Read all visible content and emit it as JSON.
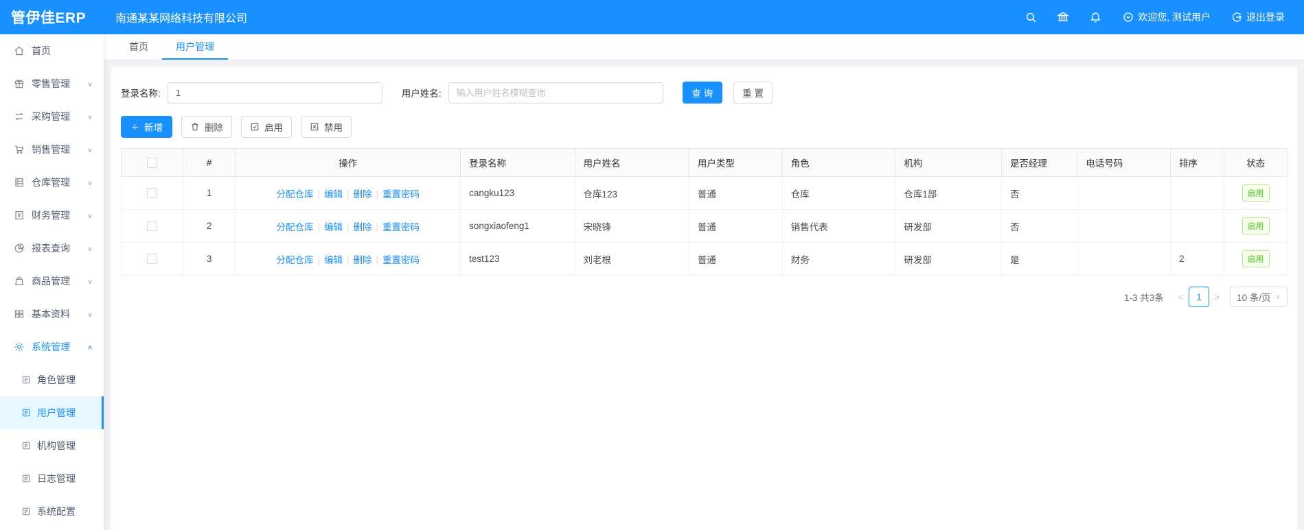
{
  "header": {
    "logo": "管伊佳ERP",
    "company": "南通某某网络科技有限公司",
    "welcome": "欢迎您, 测试用户",
    "logout": "退出登录"
  },
  "sidebar": {
    "items": [
      {
        "label": "首页"
      },
      {
        "label": "零售管理"
      },
      {
        "label": "采购管理"
      },
      {
        "label": "销售管理"
      },
      {
        "label": "仓库管理"
      },
      {
        "label": "财务管理"
      },
      {
        "label": "报表查询"
      },
      {
        "label": "商品管理"
      },
      {
        "label": "基本资料"
      },
      {
        "label": "系统管理"
      }
    ],
    "subitems": [
      {
        "label": "角色管理"
      },
      {
        "label": "用户管理"
      },
      {
        "label": "机构管理"
      },
      {
        "label": "日志管理"
      },
      {
        "label": "系统配置"
      }
    ]
  },
  "tabs": [
    {
      "label": "首页"
    },
    {
      "label": "用户管理"
    }
  ],
  "filter": {
    "login_label": "登录名称:",
    "login_value": "1",
    "name_label": "用户姓名:",
    "name_placeholder": "输入用户姓名模糊查询",
    "search_label": "查 询",
    "reset_label": "重 置"
  },
  "toolbar": {
    "add_label": "新增",
    "delete_label": "删除",
    "enable_label": "启用",
    "disable_label": "禁用"
  },
  "table": {
    "headers": [
      "#",
      "操作",
      "登录名称",
      "用户姓名",
      "用户类型",
      "角色",
      "机构",
      "是否经理",
      "电话号码",
      "排序",
      "状态"
    ],
    "actions": [
      "分配仓库",
      "编辑",
      "删除",
      "重置密码"
    ],
    "rows": [
      {
        "index": "1",
        "login": "cangku123",
        "name": "仓库123",
        "type": "普通",
        "role": "仓库",
        "org": "仓库1部",
        "manager": "否",
        "phone": "",
        "sort": "",
        "status": "启用"
      },
      {
        "index": "2",
        "login": "songxiaofeng1",
        "name": "宋晓锋",
        "type": "普通",
        "role": "销售代表",
        "org": "研发部",
        "manager": "否",
        "phone": "",
        "sort": "",
        "status": "启用"
      },
      {
        "index": "3",
        "login": "test123",
        "name": "刘老根",
        "type": "普通",
        "role": "财务",
        "org": "研发部",
        "manager": "是",
        "phone": "",
        "sort": "2",
        "status": "启用"
      }
    ]
  },
  "pagination": {
    "total": "1-3 共3条",
    "prev": "<",
    "page": "1",
    "next": ">",
    "page_size": "10 条/页"
  },
  "colors": {
    "primary": "#1890ff",
    "success": "#52c41a",
    "active_menu_bg": "#e6f7ff",
    "badge_border": "#b7eb8f",
    "body_bg": "#f0f2f5"
  }
}
